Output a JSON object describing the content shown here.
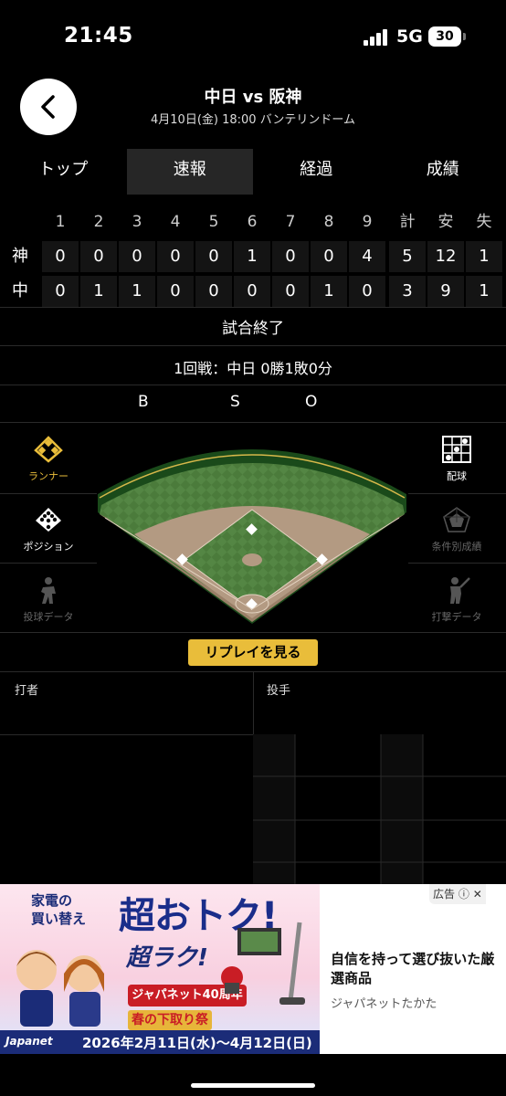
{
  "status_bar": {
    "time": "21:45",
    "network": "5G",
    "battery": "30"
  },
  "header": {
    "title": "中日 vs 阪神",
    "info": "4月10日(金) 18:00 バンテリンドーム"
  },
  "tabs": [
    {
      "label": "トップ",
      "active": false
    },
    {
      "label": "速報",
      "active": true
    },
    {
      "label": "経過",
      "active": false
    },
    {
      "label": "成績",
      "active": false
    }
  ],
  "scoreboard": {
    "headers": [
      "1",
      "2",
      "3",
      "4",
      "5",
      "6",
      "7",
      "8",
      "9",
      "計",
      "安",
      "失"
    ],
    "rows": [
      {
        "team": "神",
        "scores": [
          "0",
          "0",
          "0",
          "0",
          "0",
          "1",
          "0",
          "0",
          "4",
          "5",
          "12",
          "1"
        ]
      },
      {
        "team": "中",
        "scores": [
          "0",
          "1",
          "1",
          "0",
          "0",
          "0",
          "0",
          "1",
          "0",
          "3",
          "9",
          "1"
        ]
      }
    ]
  },
  "game_status": "試合終了",
  "series_record": "1回戦：中日 0勝1敗0分",
  "count": {
    "b": "B",
    "s": "S",
    "o": "O"
  },
  "left_menu": [
    {
      "label": "ランナー",
      "icon": "diamond-bases-icon",
      "active": true
    },
    {
      "label": "ポジション",
      "icon": "fielder-positions-icon",
      "active": false
    },
    {
      "label": "投球データ",
      "icon": "pitcher-icon",
      "active": false
    }
  ],
  "right_menu": [
    {
      "label": "配球",
      "icon": "pitch-grid-icon",
      "active": false
    },
    {
      "label": "条件別成績",
      "icon": "radar-chart-icon",
      "active": false
    },
    {
      "label": "打撃データ",
      "icon": "batter-icon",
      "active": false
    }
  ],
  "replay_button": "リプレイを見る",
  "batter_label": "打者",
  "pitcher_label": "投手",
  "ad": {
    "headline": "家電の\n買い替え",
    "big_text": "超おトク!",
    "sub_text": "超ラク!",
    "band": "ジャパネット40周年",
    "event": "春の下取り祭",
    "brand": "Japanet",
    "dates": "2026年2月11日(水)〜4月12日(日)",
    "copy": "自信を持って選び抜いた厳選商品",
    "advertiser": "ジャパネットたかた",
    "badge": "広告"
  },
  "colors": {
    "accent": "#e9bd3a",
    "grass": "#4a7a3a",
    "dirt": "#b39a82"
  }
}
